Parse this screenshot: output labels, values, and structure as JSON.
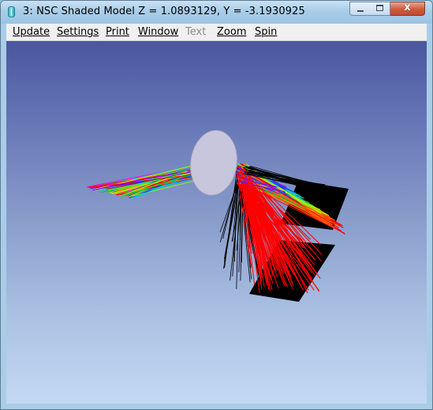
{
  "window": {
    "title": "3: NSC Shaded Model Z = 1.0893129, Y = -3.1930925",
    "icon": "app-icon",
    "controls": {
      "minimize": "minimize-icon",
      "maximize": "maximize-icon",
      "close": "close-icon",
      "close_glyph": "x"
    }
  },
  "menu": {
    "items": [
      {
        "label": "Update"
      },
      {
        "label": "Settings"
      },
      {
        "label": "Print"
      },
      {
        "label": "Window"
      },
      {
        "label": "Text",
        "disabled": true
      },
      {
        "label": "Zoom"
      },
      {
        "label": "Spin"
      }
    ]
  },
  "scene": {
    "background_top": "#4a56a0",
    "background_bottom": "#c3d9f3",
    "lens_color": "#c8c6dc",
    "detector_color": "#000000",
    "ray_colors": [
      "#ff0000",
      "#ff6a00",
      "#ffd800",
      "#7dff00",
      "#00c840",
      "#00c8c8",
      "#0040ff",
      "#8000ff",
      "#ff00ff",
      "#000000"
    ]
  }
}
